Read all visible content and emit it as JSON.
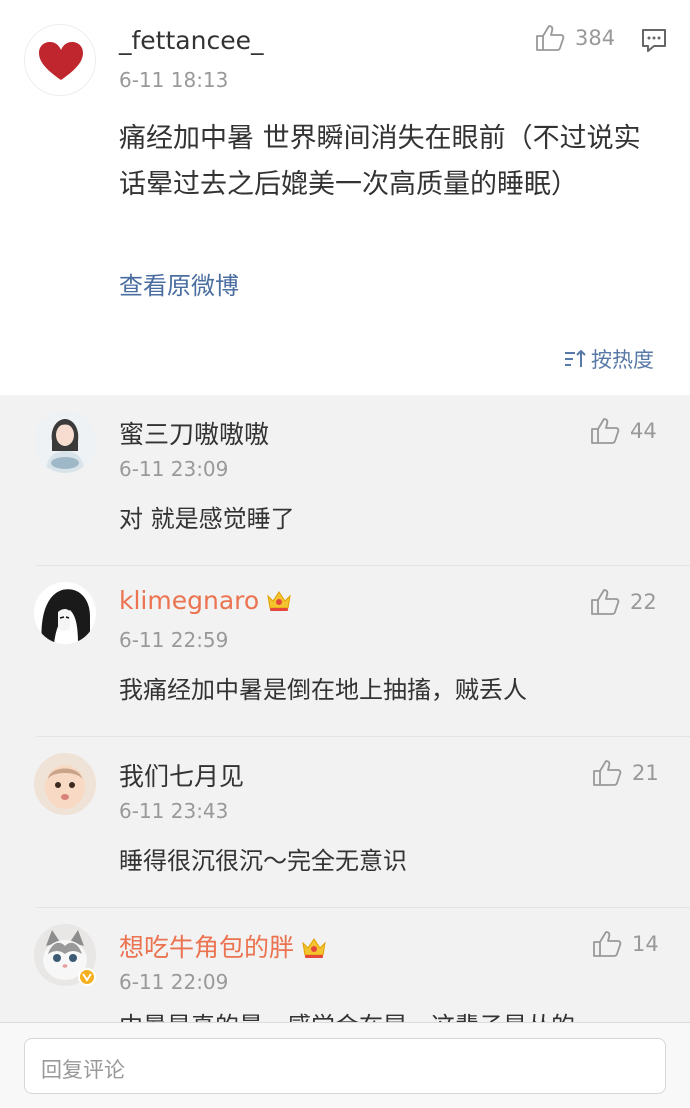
{
  "main": {
    "username": "_fettancee_",
    "timestamp": "6-11 18:13",
    "likes": "384",
    "text": "痛经加中暑 世界瞬间消失在眼前（不过说实话晕过去之后媲美一次高质量的睡眠）",
    "view_original": "查看原微博",
    "sort_label": "按热度",
    "avatar_icon": "heart-icon",
    "reply_icon": "comment-icon"
  },
  "replies": [
    {
      "username": "蜜三刀嗷嗷嗷",
      "timestamp": "6-11 23:09",
      "likes": "44",
      "text": "对 就是感觉睡了",
      "vip": false
    },
    {
      "username": "klimegnaro",
      "timestamp": "6-11 22:59",
      "likes": "22",
      "text": "我痛经加中暑是倒在地上抽搐，贼丢人",
      "vip": true
    },
    {
      "username": "我们七月见",
      "timestamp": "6-11 23:43",
      "likes": "21",
      "text": "睡得很沉很沉～完全无意识",
      "vip": false
    },
    {
      "username": "想吃牛角包的胖",
      "timestamp": "6-11 22:09",
      "likes": "14",
      "text": "中暑是真的晕，感觉会在晃，这辈子是丛的一",
      "vip": true
    }
  ],
  "bottom": {
    "placeholder": "回复评论"
  },
  "colors": {
    "vip_name": "#eb7350",
    "link": "#4a6da0",
    "meta": "#999999"
  }
}
